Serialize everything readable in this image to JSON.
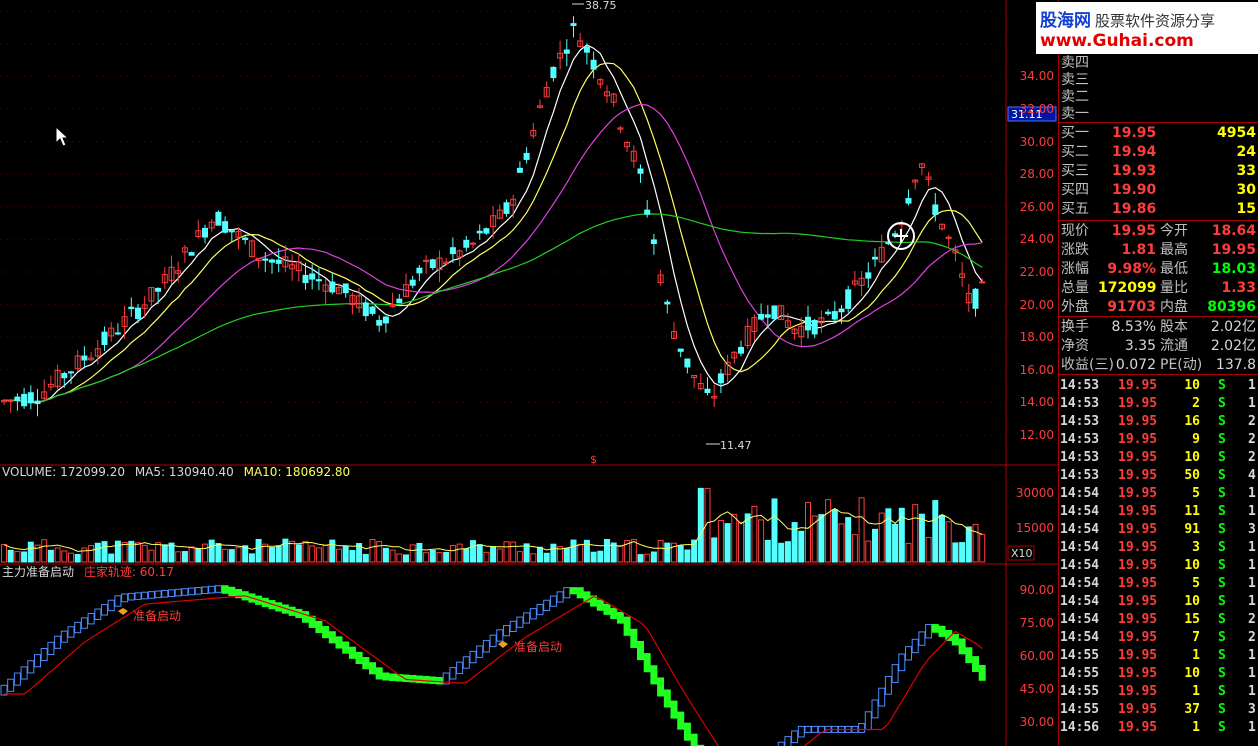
{
  "brand": {
    "name": "股海网",
    "slogan": "股票软件资源分享",
    "url": "www.Guhai.com"
  },
  "price_axis": [
    "34.00",
    "32.00",
    "30.00",
    "28.00",
    "26.00",
    "24.00",
    "22.00",
    "20.00",
    "18.00",
    "16.00",
    "14.00",
    "12.00"
  ],
  "price_marker": "31.11",
  "high_label": "38.75",
  "low_label": "11.47",
  "volume_header": {
    "volume": "VOLUME: 172099.20",
    "ma5": "MA5: 130940.40",
    "ma10": "MA10: 180692.80"
  },
  "volume_axis": [
    "30000",
    "15000"
  ],
  "volume_unit": "X10",
  "indicator_header": {
    "name": "主力准备启动",
    "line": "庄家轨迹: 60.17"
  },
  "indicator_axis": [
    "90.00",
    "75.00",
    "60.00",
    "45.00",
    "30.00"
  ],
  "signal_label": "准备启动",
  "sell_levels": [
    {
      "label": "卖四"
    },
    {
      "label": "卖三"
    },
    {
      "label": "卖二"
    },
    {
      "label": "卖一"
    }
  ],
  "buy_levels": [
    {
      "label": "买一",
      "price": "19.95",
      "vol": "4954"
    },
    {
      "label": "买二",
      "price": "19.94",
      "vol": "24"
    },
    {
      "label": "买三",
      "price": "19.93",
      "vol": "33"
    },
    {
      "label": "买四",
      "price": "19.90",
      "vol": "30"
    },
    {
      "label": "买五",
      "price": "19.86",
      "vol": "15"
    }
  ],
  "stats": [
    {
      "l1": "现价",
      "v1": "19.95",
      "l2": "今开",
      "v2": "18.64"
    },
    {
      "l1": "涨跌",
      "v1": "1.81",
      "l2": "最高",
      "v2": "19.95"
    },
    {
      "l1": "涨幅",
      "v1": "9.98%",
      "l2": "最低",
      "v2": "18.03"
    },
    {
      "l1": "总量",
      "v1": "172099",
      "l2": "量比",
      "v2": "1.33"
    },
    {
      "l1": "外盘",
      "v1": "91703",
      "l2": "内盘",
      "v2": "80396"
    }
  ],
  "stats2": [
    {
      "l1": "换手",
      "v1": "8.53%",
      "l2": "股本",
      "v2": "2.02亿"
    },
    {
      "l1": "净资",
      "v1": "3.35",
      "l2": "流通",
      "v2": "2.02亿"
    },
    {
      "l1": "收益(三)",
      "v1": "0.072",
      "l2": "PE(动)",
      "v2": "137.8"
    }
  ],
  "trades": [
    {
      "time": "14:53",
      "price": "19.95",
      "vol": "10",
      "side": "S",
      "n": "1"
    },
    {
      "time": "14:53",
      "price": "19.95",
      "vol": "2",
      "side": "S",
      "n": "1"
    },
    {
      "time": "14:53",
      "price": "19.95",
      "vol": "16",
      "side": "S",
      "n": "2"
    },
    {
      "time": "14:53",
      "price": "19.95",
      "vol": "9",
      "side": "S",
      "n": "2"
    },
    {
      "time": "14:53",
      "price": "19.95",
      "vol": "10",
      "side": "S",
      "n": "2"
    },
    {
      "time": "14:53",
      "price": "19.95",
      "vol": "50",
      "side": "S",
      "n": "4"
    },
    {
      "time": "14:54",
      "price": "19.95",
      "vol": "5",
      "side": "S",
      "n": "1"
    },
    {
      "time": "14:54",
      "price": "19.95",
      "vol": "11",
      "side": "S",
      "n": "1"
    },
    {
      "time": "14:54",
      "price": "19.95",
      "vol": "91",
      "side": "S",
      "n": "3"
    },
    {
      "time": "14:54",
      "price": "19.95",
      "vol": "3",
      "side": "S",
      "n": "1"
    },
    {
      "time": "14:54",
      "price": "19.95",
      "vol": "10",
      "side": "S",
      "n": "1"
    },
    {
      "time": "14:54",
      "price": "19.95",
      "vol": "5",
      "side": "S",
      "n": "1"
    },
    {
      "time": "14:54",
      "price": "19.95",
      "vol": "10",
      "side": "S",
      "n": "1"
    },
    {
      "time": "14:54",
      "price": "19.95",
      "vol": "15",
      "side": "S",
      "n": "2"
    },
    {
      "time": "14:54",
      "price": "19.95",
      "vol": "7",
      "side": "S",
      "n": "2"
    },
    {
      "time": "14:55",
      "price": "19.95",
      "vol": "1",
      "side": "S",
      "n": "1"
    },
    {
      "time": "14:55",
      "price": "19.95",
      "vol": "10",
      "side": "S",
      "n": "1"
    },
    {
      "time": "14:55",
      "price": "19.95",
      "vol": "1",
      "side": "S",
      "n": "1"
    },
    {
      "time": "14:55",
      "price": "19.95",
      "vol": "37",
      "side": "S",
      "n": "3"
    },
    {
      "time": "14:56",
      "price": "19.95",
      "vol": "1",
      "side": "S",
      "n": "1"
    }
  ],
  "colors": {
    "up": "#ff3c3c",
    "down": "#54ffff",
    "ma5": "#ffffff",
    "ma10": "#ffff60",
    "ma20": "#e040e0",
    "ma60": "#20d020",
    "grid": "#a00000"
  }
}
